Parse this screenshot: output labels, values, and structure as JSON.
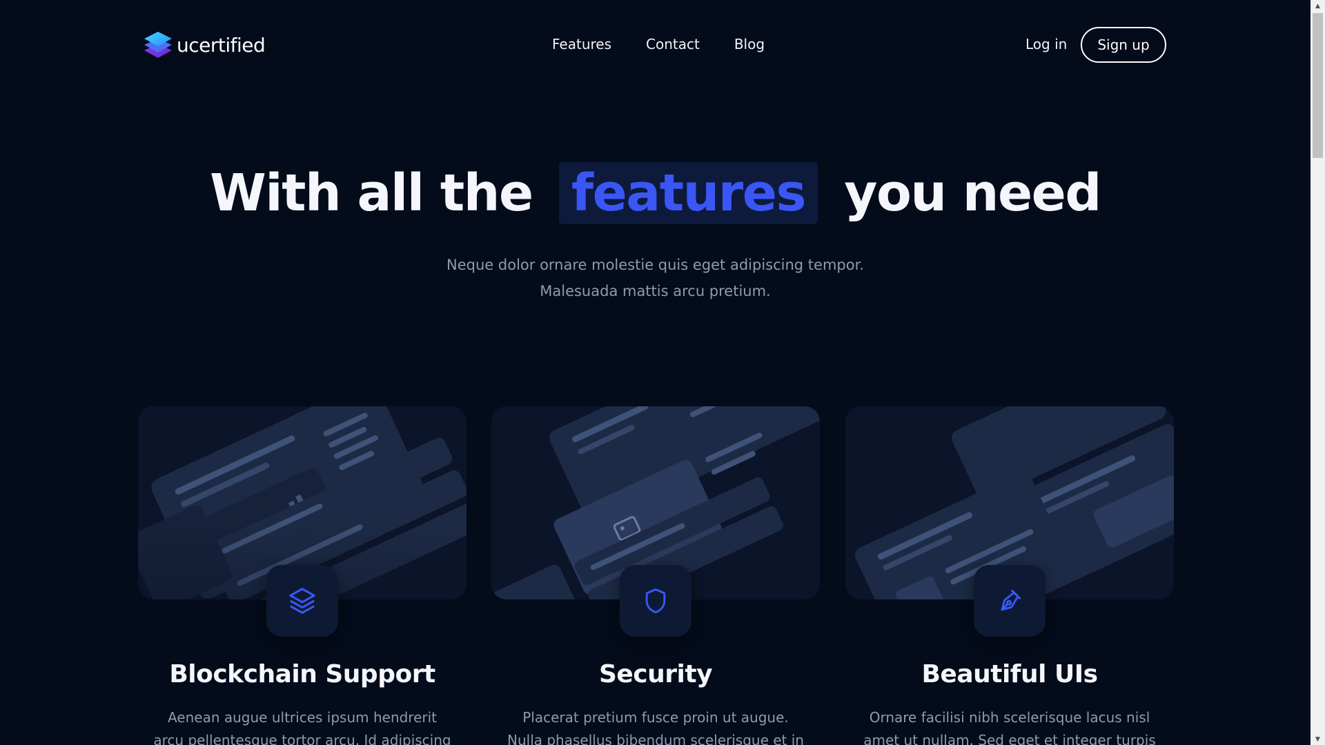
{
  "header": {
    "brand": "ucertified",
    "nav": [
      {
        "label": "Features"
      },
      {
        "label": "Contact"
      },
      {
        "label": "Blog"
      }
    ],
    "login_label": "Log in",
    "signup_label": "Sign up"
  },
  "hero": {
    "title_before": "With all the",
    "title_highlight": "features",
    "title_after": "you need",
    "subtitle_line1": "Neque dolor ornare molestie quis eget adipiscing tempor.",
    "subtitle_line2": "Malesuada mattis arcu pretium."
  },
  "features": [
    {
      "icon": "layers-icon",
      "title": "Blockchain Support",
      "text": "Aenean augue ultrices ipsum hendrerit arcu pellentesque tortor arcu. Id adipiscing"
    },
    {
      "icon": "shield-icon",
      "title": "Security",
      "text": "Placerat pretium fusce proin ut augue. Nulla phasellus bibendum scelerisque et in"
    },
    {
      "icon": "pen-tool-icon",
      "title": "Beautiful UIs",
      "text": "Ornare facilisi nibh scelerisque lacus nisl amet ut nullam. Sed eget et integer turpis"
    }
  ],
  "colors": {
    "background": "#040b1a",
    "accent": "#3a57f5",
    "highlight_bg": "#0d1a3c",
    "muted_text": "#8f9bb2",
    "card_bg": "#0b1428"
  }
}
